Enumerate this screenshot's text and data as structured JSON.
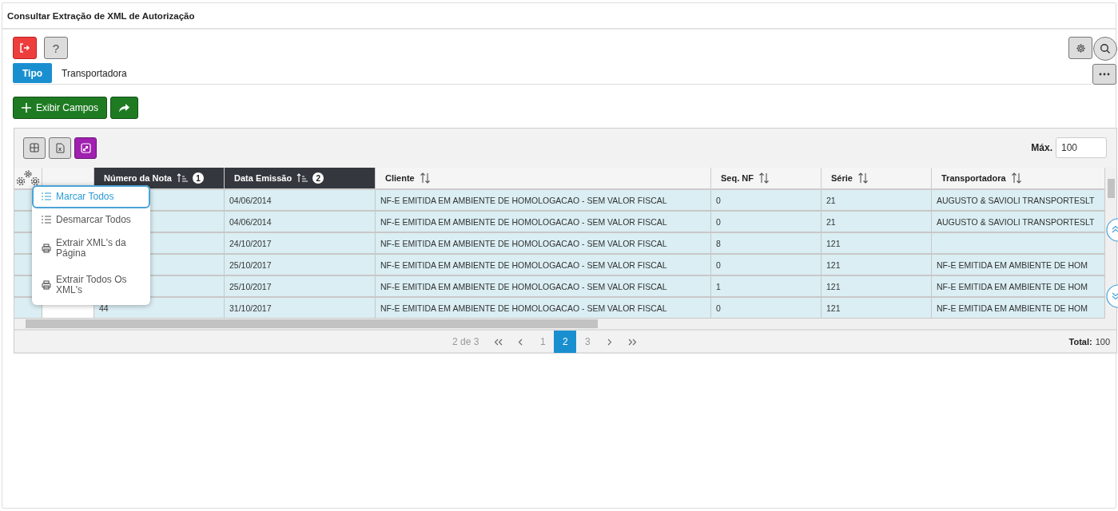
{
  "window": {
    "title": "Consultar Extração de XML de Autorização"
  },
  "toolbar": {
    "help_label": "?"
  },
  "tabs": [
    {
      "label": "Tipo",
      "selected": true
    },
    {
      "label": "Transportadora",
      "selected": false
    }
  ],
  "actions": {
    "show_fields": "Exibir Campos"
  },
  "grid": {
    "max_label": "Máx.",
    "max_value": "100",
    "columns": [
      {
        "label": "Número da Nota",
        "sorted": true,
        "sort_order": "1"
      },
      {
        "label": "Data Emissão",
        "sorted": true,
        "sort_order": "2"
      },
      {
        "label": "Cliente",
        "sorted": false
      },
      {
        "label": "Seq. NF",
        "sorted": false
      },
      {
        "label": "Série",
        "sorted": false
      },
      {
        "label": "Transportadora",
        "sorted": false
      }
    ],
    "rows": [
      {
        "selected": true,
        "cells": [
          null,
          "04/06/2014",
          "NF-E EMITIDA EM AMBIENTE DE HOMOLOGACAO - SEM VALOR FISCAL",
          "0",
          "21",
          "AUGUSTO & SAVIOLI TRANSPORTESLT"
        ]
      },
      {
        "selected": true,
        "cells": [
          null,
          "04/06/2014",
          "NF-E EMITIDA EM AMBIENTE DE HOMOLOGACAO - SEM VALOR FISCAL",
          "0",
          "21",
          "AUGUSTO & SAVIOLI TRANSPORTESLT"
        ]
      },
      {
        "selected": true,
        "cells": [
          null,
          "24/10/2017",
          "NF-E EMITIDA EM AMBIENTE DE HOMOLOGACAO - SEM VALOR FISCAL",
          "8",
          "121",
          null
        ]
      },
      {
        "selected": true,
        "cells": [
          null,
          "25/10/2017",
          "NF-E EMITIDA EM AMBIENTE DE HOMOLOGACAO - SEM VALOR FISCAL",
          "0",
          "121",
          "NF-E EMITIDA EM AMBIENTE DE HOM"
        ]
      },
      {
        "selected": true,
        "cells": [
          null,
          "25/10/2017",
          "NF-E EMITIDA EM AMBIENTE DE HOMOLOGACAO - SEM VALOR FISCAL",
          "1",
          "121",
          "NF-E EMITIDA EM AMBIENTE DE HOM"
        ]
      },
      {
        "selected": true,
        "cells": [
          "44",
          "31/10/2017",
          "NF-E EMITIDA EM AMBIENTE DE HOMOLOGACAO - SEM VALOR FISCAL",
          "0",
          "121",
          "NF-E EMITIDA EM AMBIENTE DE HOM"
        ]
      }
    ],
    "menu": [
      {
        "label": "Marcar Todos",
        "kind": "list",
        "selected": true
      },
      {
        "label": "Desmarcar Todos",
        "kind": "list",
        "selected": false
      },
      {
        "label": "Extrair XML's da Página",
        "kind": "print",
        "selected": false
      },
      {
        "label": "Extrair Todos Os XML's",
        "kind": "print",
        "selected": false
      }
    ],
    "pagination": {
      "summary": "2 de 3",
      "pages": [
        {
          "label": "1",
          "selected": false
        },
        {
          "label": "2",
          "selected": true
        },
        {
          "label": "3",
          "selected": false
        }
      ],
      "total_label": "Total:",
      "total_value": "100"
    }
  }
}
